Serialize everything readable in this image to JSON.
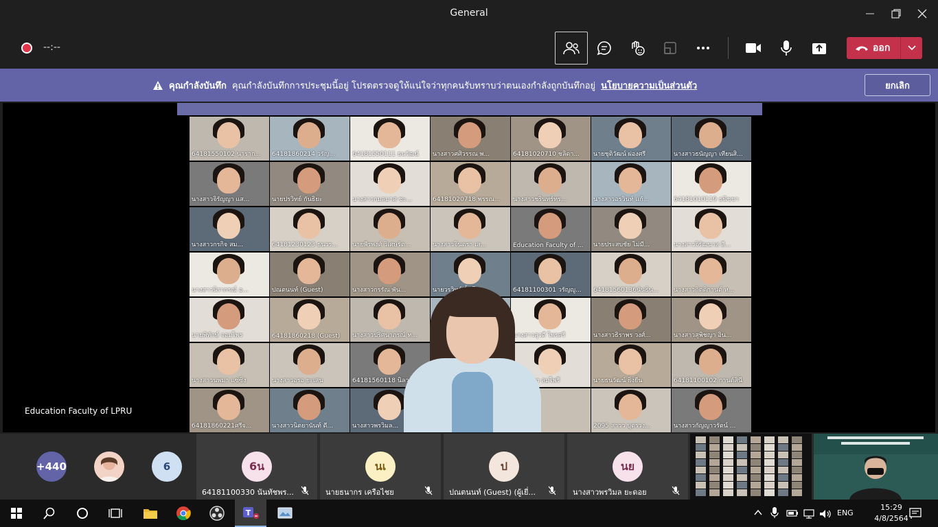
{
  "window": {
    "title": "General"
  },
  "toolbar": {
    "timer": "--:--",
    "leave_label": "ออก"
  },
  "banner": {
    "title": "คุณกำลังบันทึก",
    "message": "คุณกำลังบันทึกการประชุมนี้อยู่ โปรดตรวจดูให้แน่ใจว่าทุกคนรับทราบว่าตนเองกำลังถูกบันทึกอยู่",
    "link": "นโยบายความเป็นส่วนตัว",
    "dismiss": "ยกเลิก"
  },
  "stage": {
    "label": "Education Faculty of LPRU",
    "tiles": [
      "64181550102 นาราก...",
      "64181860214 วรัญ...",
      "64181550111 ธนวัฒน์",
      "นางสาวศศิวรรณ พ...",
      "64181020710 ชลิดา...",
      "นายชุติวัฒน์ ผ่องศรี",
      "นางสาวธนัญญา เทียนสิ...",
      "นางสาวจิรัญญา แส...",
      "นายปรวิทย์ กันธิยะ",
      "นางสาวกมลมาศ ชะ...",
      "64181020718 พรรณ...",
      "นางสาวชรินทร์ทร...",
      "นางสาวอรวินท์ แก้...",
      "64181010119 ธนิชชา",
      "นางสาวกรกิจ สม...",
      "64181230123 ธนวร...",
      "นายพีรพงศ์ วิเศษรัต...",
      "นางสาวจินตรา เส...",
      "Education Faculty of ...",
      "นายประสบชัย ไม่มี...",
      "นางสาวจิรัฒนาส สี...",
      "นางสาวนิรากรณ์ อ...",
      "ปณตนนท์ (Guest)",
      "นางสาวกรรัณ พัน...",
      "นายวรวิทย์ ปั้นโต",
      "64181100301 วรัญญู...",
      "64181560136นันธิน...",
      "นางสาวกิตติกานต์ ห...",
      "นายพิทักษ์ จอมไพร",
      "64181860218 (Guest)",
      "นางสาวปริศนาภรณ์ ท...",
      "",
      "นางสาวสุวดี ไพรศรี",
      "นางสาวธิราพร วงศ์...",
      "นางสาวสุพิชญา อิน...",
      "นางสาวนพมา แซ่ซิ่ง",
      "นางสาวอรอ ยะเสน",
      "64181560118 นิลวร...",
      "",
      "นายวิชชา สมไพรี",
      "นายธนวัฒน์ ยิ่งยืน",
      "64181100102 กานต์สินี",
      "64181860221ศรีจ...",
      "นางสาวนิตยานันท์ ดี...",
      "นางสาวพรวิมล...",
      "",
      "",
      "2095 สาวว บุตรวง...",
      "นางสาวกัญญาวรัตน์ ..."
    ]
  },
  "participants": {
    "overflow": "+440",
    "count_badge": "6",
    "tiles": [
      {
        "initials": "6น",
        "name": "64181100330 นันทัชพร..."
      },
      {
        "initials": "นเ",
        "name": "นายธนากร เครือไชย"
      },
      {
        "initials": "ป",
        "name": "ปณตนนท์ (Guest) (ผู้เยี่..."
      },
      {
        "initials": "นย",
        "name": "นางสาวพรวิมล ยะดอย"
      }
    ]
  },
  "taskbar": {
    "lang": "ENG",
    "time": "15:29",
    "date": "4/8/2564"
  },
  "colors": {
    "accent": "#6264a7",
    "leave": "#c4314b",
    "record": "#e0354a"
  }
}
